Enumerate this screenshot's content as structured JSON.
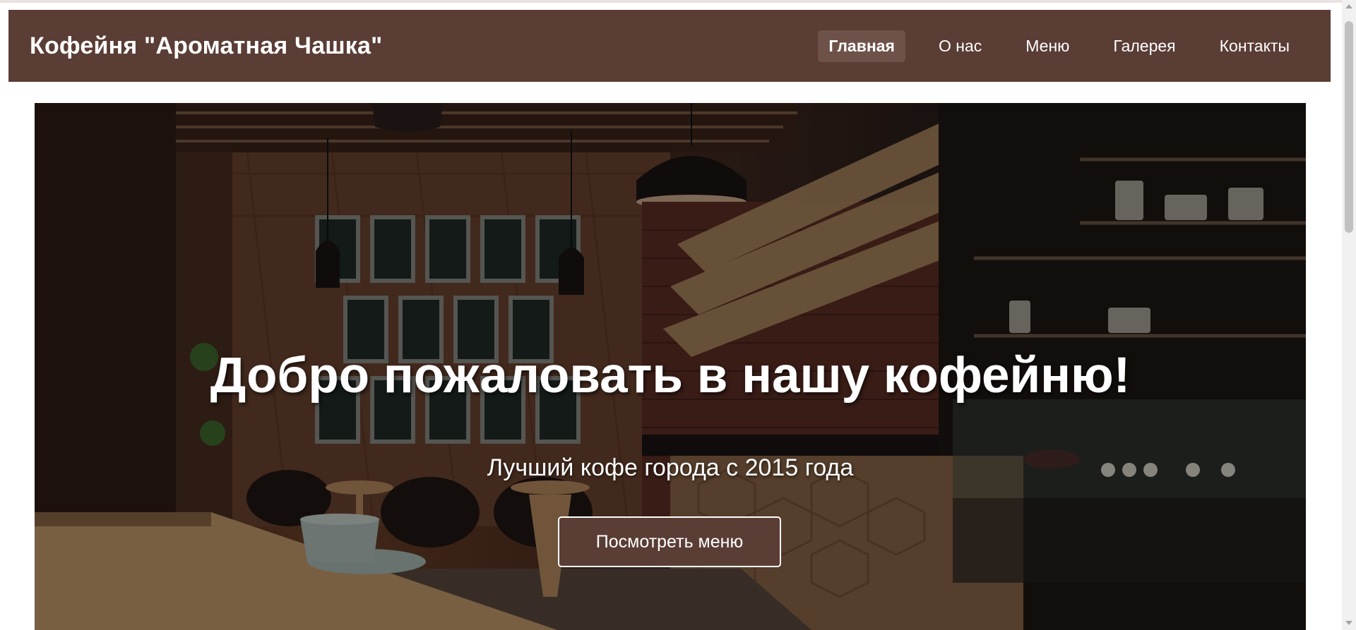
{
  "header": {
    "logo": "Кофейня \"Ароматная Чашка\"",
    "nav": [
      {
        "label": "Главная",
        "active": true
      },
      {
        "label": "О нас",
        "active": false
      },
      {
        "label": "Меню",
        "active": false
      },
      {
        "label": "Галерея",
        "active": false
      },
      {
        "label": "Контакты",
        "active": false
      }
    ]
  },
  "hero": {
    "title": "Добро пожаловать в нашу кофейню!",
    "subtitle": "Лучший кофе города с 2015 года",
    "button_label": "Посмотреть меню"
  },
  "colors": {
    "header_bg": "#5a3d35",
    "nav_active_bg": "#6e5249",
    "button_bg": "#5a3d35",
    "text": "#ffffff"
  }
}
